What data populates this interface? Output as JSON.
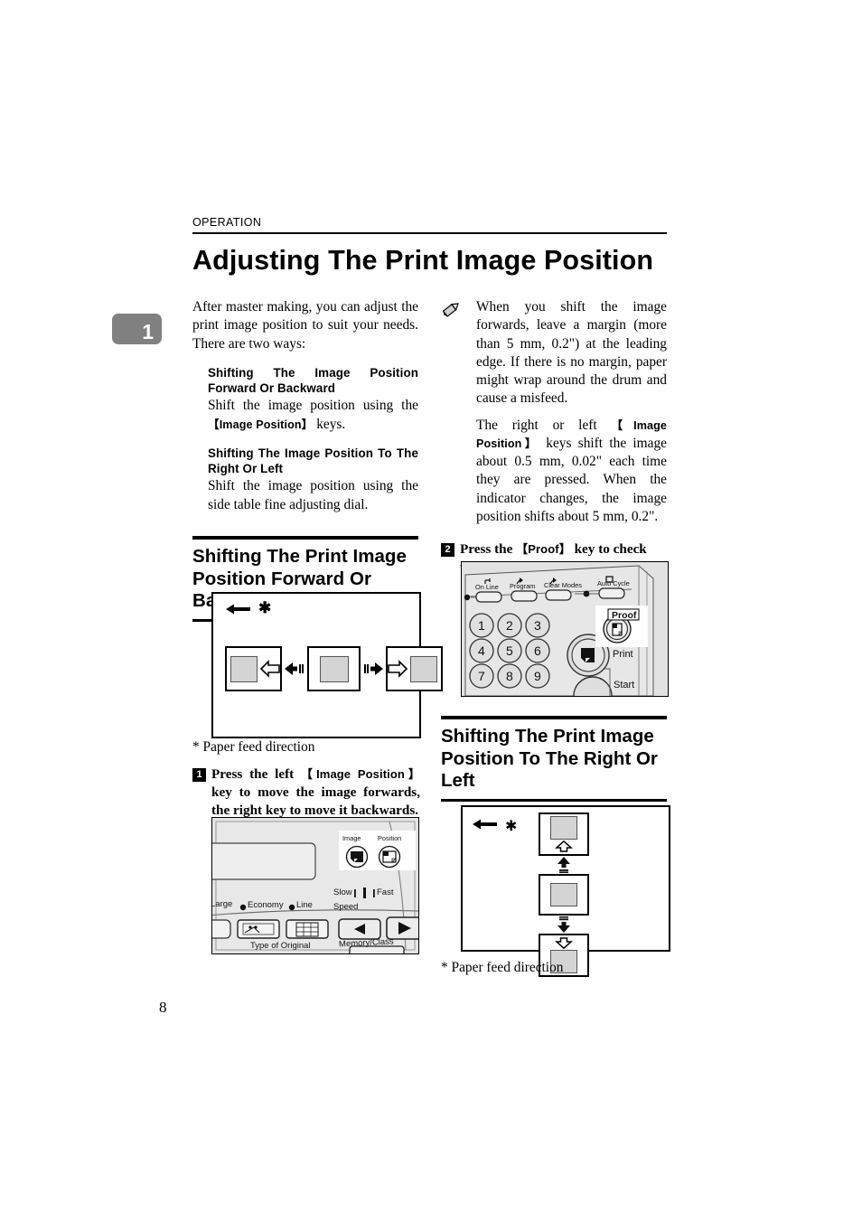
{
  "page": {
    "running_head": "OPERATION",
    "chapter_tab": "1",
    "title": "Adjusting The Print Image Position",
    "page_number": "8"
  },
  "left_column": {
    "intro": "After master making, you can adjust the print image position to suit your needs. There are two ways:",
    "sub_sections": [
      {
        "heading": "Shifting The Image Position Forward Or Backward",
        "body_before": "Shift the image position using the ",
        "key": "【Image Position】",
        "body_after": " keys."
      },
      {
        "heading": "Shifting The Image Position To The Right Or Left",
        "body": "Shift the image position using the side table fine adjusting dial."
      }
    ],
    "section_heading": "Shifting The Print Image Position Forward Or Backward",
    "figure_caption": "* Paper feed direction",
    "step": {
      "number": "1",
      "text_part1": "Press the left ",
      "key": "【Image Position】",
      "text_part2": " key to move the image forwards, the right key to move it backwards."
    },
    "control_panel_labels": {
      "image": "Image",
      "position": "Position",
      "large": "Large",
      "economy": "Economy",
      "line": "Line",
      "slow": "Slow",
      "fast": "Fast",
      "speed": "Speed",
      "type_of_original": "Type of Original",
      "memory_class": "Memory/Class"
    }
  },
  "right_column": {
    "note_icon": "pencil-note-icon",
    "notes": [
      "When you shift the image forwards, leave a margin (more than 5 mm, 0.2\") at the leading edge. If there is no margin, paper might wrap around the drum and cause a misfeed.",
      {
        "part1": "The right or left ",
        "key": "【Image Position】",
        "part2": " keys shift the image about 0.5 mm, 0.02\" each time they are pressed. When the indicator changes, the image position shifts about 5 mm, 0.2\"."
      }
    ],
    "step": {
      "number": "2",
      "text_part1": "Press the ",
      "key": "【Proof】",
      "text_part2": " key to check the image position."
    },
    "keypad_labels": {
      "on_line": "On Line",
      "program": "Program",
      "clear_modes": "Clear Modes",
      "auto_cycle": "Auto Cycle",
      "proof": "Proof",
      "print": "Print",
      "start": "Start",
      "digits": [
        "1",
        "2",
        "3",
        "4",
        "5",
        "6",
        "7",
        "8",
        "9"
      ]
    },
    "section_heading": "Shifting The Print Image Position To The Right Or Left",
    "figure_caption": "* Paper feed direction"
  },
  "colors": {
    "ink": "#000000",
    "chapter_tab_bg": "#808080",
    "panel_gray": "#e3e3e3",
    "image_block": "#d4d4d4"
  }
}
